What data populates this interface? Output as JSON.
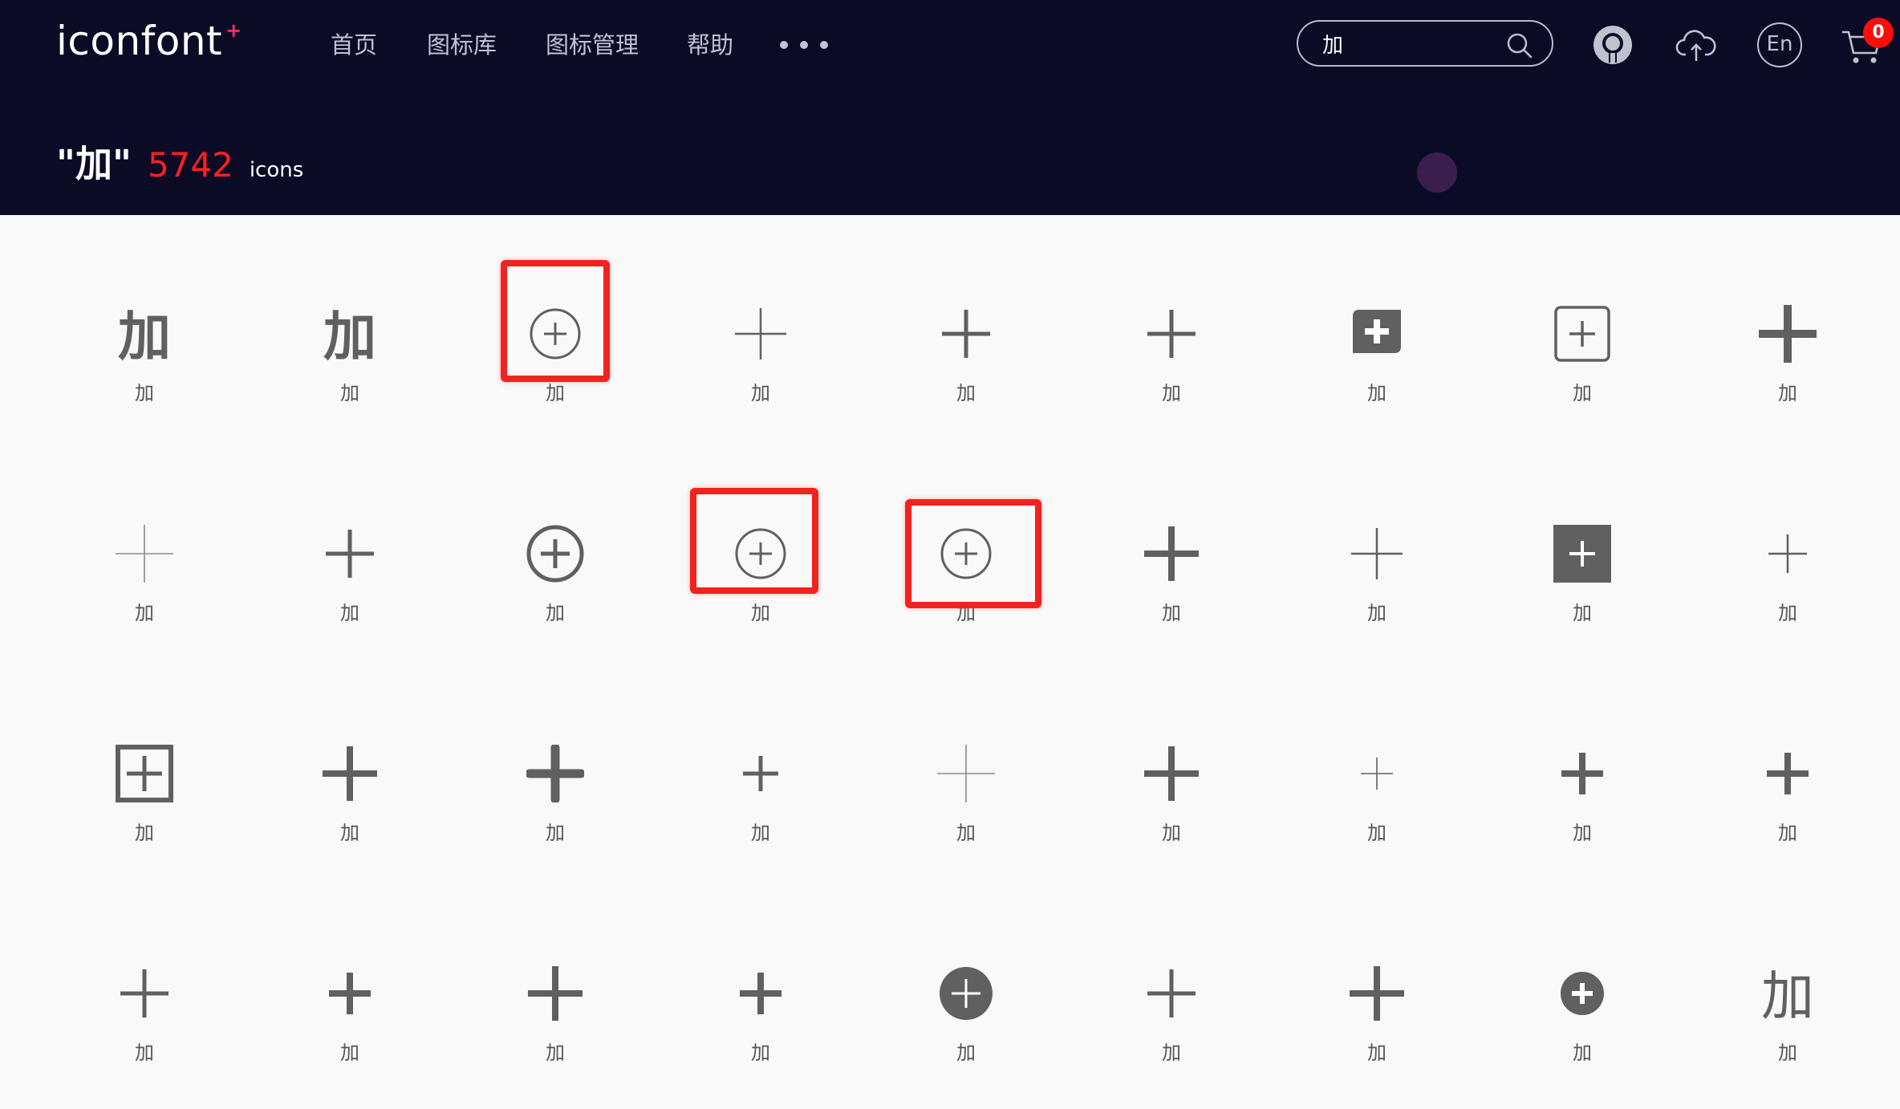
{
  "header": {
    "logo_text": "iconfont",
    "logo_mark": "+",
    "nav": [
      {
        "label": "首页"
      },
      {
        "label": "图标库"
      },
      {
        "label": "图标管理"
      },
      {
        "label": "帮助"
      }
    ],
    "search": {
      "value": "加",
      "icon": "search-icon"
    },
    "icons": [
      "github-icon",
      "upload-cloud-icon",
      "language-en-icon",
      "cart-icon"
    ],
    "lang_label": "En",
    "cart_count": "0",
    "accent_color": "#ff2d6b"
  },
  "result": {
    "query": "\"加\"",
    "count": "5742",
    "unit": "icons",
    "count_color": "#ff1f1f"
  },
  "icons": [
    {
      "label": "加",
      "glyph": "char-bold"
    },
    {
      "label": "加",
      "glyph": "char-bold"
    },
    {
      "label": "加",
      "glyph": "plus-circle-thin",
      "highlighted": true
    },
    {
      "label": "加",
      "glyph": "plus-thin"
    },
    {
      "label": "加",
      "glyph": "plus-medium"
    },
    {
      "label": "加",
      "glyph": "plus-medium"
    },
    {
      "label": "加",
      "glyph": "plus-bubble-filled"
    },
    {
      "label": "加",
      "glyph": "plus-square-outline"
    },
    {
      "label": "加",
      "glyph": "plus-bold-large"
    },
    {
      "label": "加",
      "glyph": "plus-hairline"
    },
    {
      "label": "加",
      "glyph": "plus-medium"
    },
    {
      "label": "加",
      "glyph": "plus-circle-bold"
    },
    {
      "label": "加",
      "glyph": "plus-circle-thin",
      "highlighted": true
    },
    {
      "label": "加",
      "glyph": "plus-circle-thin",
      "highlighted": true
    },
    {
      "label": "加",
      "glyph": "plus-bold"
    },
    {
      "label": "加",
      "glyph": "plus-thin"
    },
    {
      "label": "加",
      "glyph": "plus-square-filled"
    },
    {
      "label": "加",
      "glyph": "plus-thin-small"
    },
    {
      "label": "加",
      "glyph": "plus-square-bold"
    },
    {
      "label": "加",
      "glyph": "plus-bold"
    },
    {
      "label": "加",
      "glyph": "plus-rounded-bold"
    },
    {
      "label": "加",
      "glyph": "plus-medium-small"
    },
    {
      "label": "加",
      "glyph": "plus-hairline"
    },
    {
      "label": "加",
      "glyph": "plus-bold"
    },
    {
      "label": "加",
      "glyph": "plus-hairline-small"
    },
    {
      "label": "加",
      "glyph": "plus-bold-small"
    },
    {
      "label": "加",
      "glyph": "plus-bold-small"
    },
    {
      "label": "加",
      "glyph": "plus-medium"
    },
    {
      "label": "加",
      "glyph": "plus-bold-small"
    },
    {
      "label": "加",
      "glyph": "plus-bold"
    },
    {
      "label": "加",
      "glyph": "plus-bold-small"
    },
    {
      "label": "加",
      "glyph": "plus-circle-filled"
    },
    {
      "label": "加",
      "glyph": "plus-medium"
    },
    {
      "label": "加",
      "glyph": "plus-bold"
    },
    {
      "label": "加",
      "glyph": "plus-circle-filled-small"
    },
    {
      "label": "加",
      "glyph": "char-thin"
    }
  ]
}
